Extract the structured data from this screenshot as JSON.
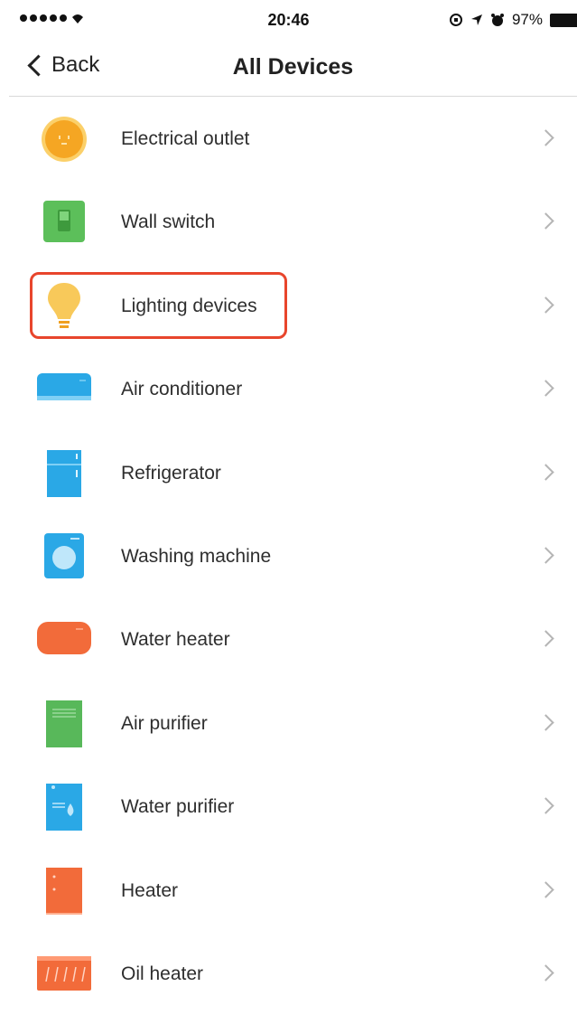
{
  "status_bar": {
    "time": "20:46",
    "battery": "97%"
  },
  "nav": {
    "back_label": "Back",
    "title": "All Devices"
  },
  "devices": [
    {
      "label": "Electrical outlet",
      "icon": "outlet-icon"
    },
    {
      "label": "Wall switch",
      "icon": "wall-switch-icon"
    },
    {
      "label": "Lighting devices",
      "icon": "light-bulb-icon",
      "highlighted": true
    },
    {
      "label": "Air conditioner",
      "icon": "air-conditioner-icon"
    },
    {
      "label": "Refrigerator",
      "icon": "refrigerator-icon"
    },
    {
      "label": "Washing machine",
      "icon": "washing-machine-icon"
    },
    {
      "label": "Water heater",
      "icon": "water-heater-icon"
    },
    {
      "label": "Air purifier",
      "icon": "air-purifier-icon"
    },
    {
      "label": "Water purifier",
      "icon": "water-purifier-icon"
    },
    {
      "label": "Heater",
      "icon": "heater-icon"
    },
    {
      "label": "Oil heater",
      "icon": "oil-heater-icon"
    }
  ],
  "colors": {
    "highlight": "#e8452c",
    "outlet": "#f5a623",
    "switch": "#5cbf5a",
    "bulb": "#f8c95a",
    "blue": "#2aa8e6",
    "orange": "#f26b3a",
    "green": "#58b85a"
  }
}
